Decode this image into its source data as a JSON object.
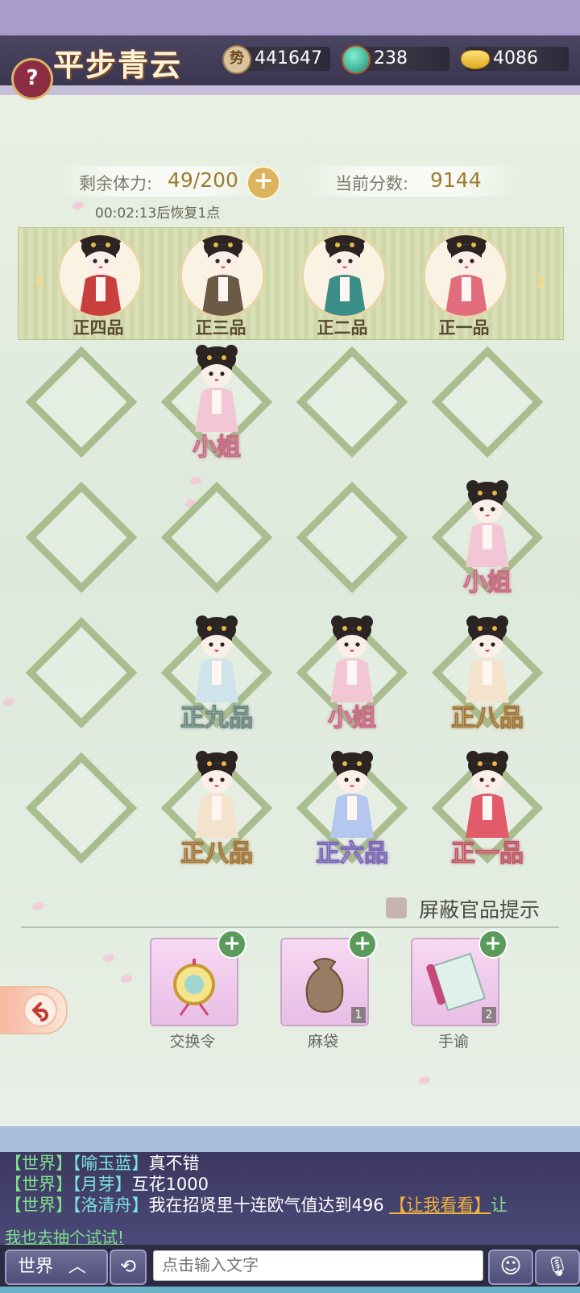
{
  "header": {
    "title": "平步青云",
    "help_symbol": "?",
    "currency": {
      "influence": {
        "icon": "influence-coin-icon",
        "value": "441647",
        "icon_char": "势"
      },
      "jade": {
        "icon": "jade-orb-icon",
        "value": "238"
      },
      "gold": {
        "icon": "gold-ingot-icon",
        "value": "4086"
      }
    }
  },
  "stamina": {
    "label": "剩余体力:",
    "value": "49/200",
    "plus": "+",
    "timer": "00:02:13后恢复1点"
  },
  "score": {
    "label": "当前分数:",
    "value": "9144"
  },
  "ranks": [
    {
      "label": "正四品",
      "color": "#c8403e"
    },
    {
      "label": "正三品",
      "color": "#6b5a46"
    },
    {
      "label": "正二品",
      "color": "#3c8f88"
    },
    {
      "label": "正一品",
      "color": "#e06c7c"
    }
  ],
  "board": {
    "rows": [
      [
        null,
        {
          "label": "小姐",
          "style": "pink"
        },
        null,
        null
      ],
      [
        null,
        null,
        null,
        {
          "label": "小姐",
          "style": "pink"
        }
      ],
      [
        null,
        {
          "label": "正九品",
          "style": "teal"
        },
        {
          "label": "小姐",
          "style": "pink"
        },
        {
          "label": "正八品",
          "style": "gold"
        }
      ],
      [
        null,
        {
          "label": "正八品",
          "style": "gold"
        },
        {
          "label": "正六品",
          "style": "purple"
        },
        {
          "label": "正一品",
          "style": "red"
        }
      ]
    ]
  },
  "hide_rank_hint": {
    "label": "屏蔽官品提示",
    "checked": false
  },
  "items": [
    {
      "name": "交换令",
      "icon": "exchange-token-icon",
      "count": ""
    },
    {
      "name": "麻袋",
      "icon": "sack-icon",
      "count": "1"
    },
    {
      "name": "手谕",
      "icon": "scroll-icon",
      "count": "2"
    }
  ],
  "chat": {
    "lines": [
      {
        "channel": "【世界】",
        "user": "【喻玉蓝】",
        "text": "真不错",
        "link": "",
        "tail": ""
      },
      {
        "channel": "【世界】",
        "user": "【月芽】",
        "text": "互花1000",
        "link": "",
        "tail": ""
      },
      {
        "channel": "【世界】",
        "user": "【洛清舟】",
        "text": "我在招贤里十连欧气值达到496",
        "link": "【让我看看】",
        "tail": "让"
      }
    ],
    "overflow": "我也去抽个试试!",
    "channel_button": "世界",
    "input_placeholder": "点击输入文字"
  }
}
